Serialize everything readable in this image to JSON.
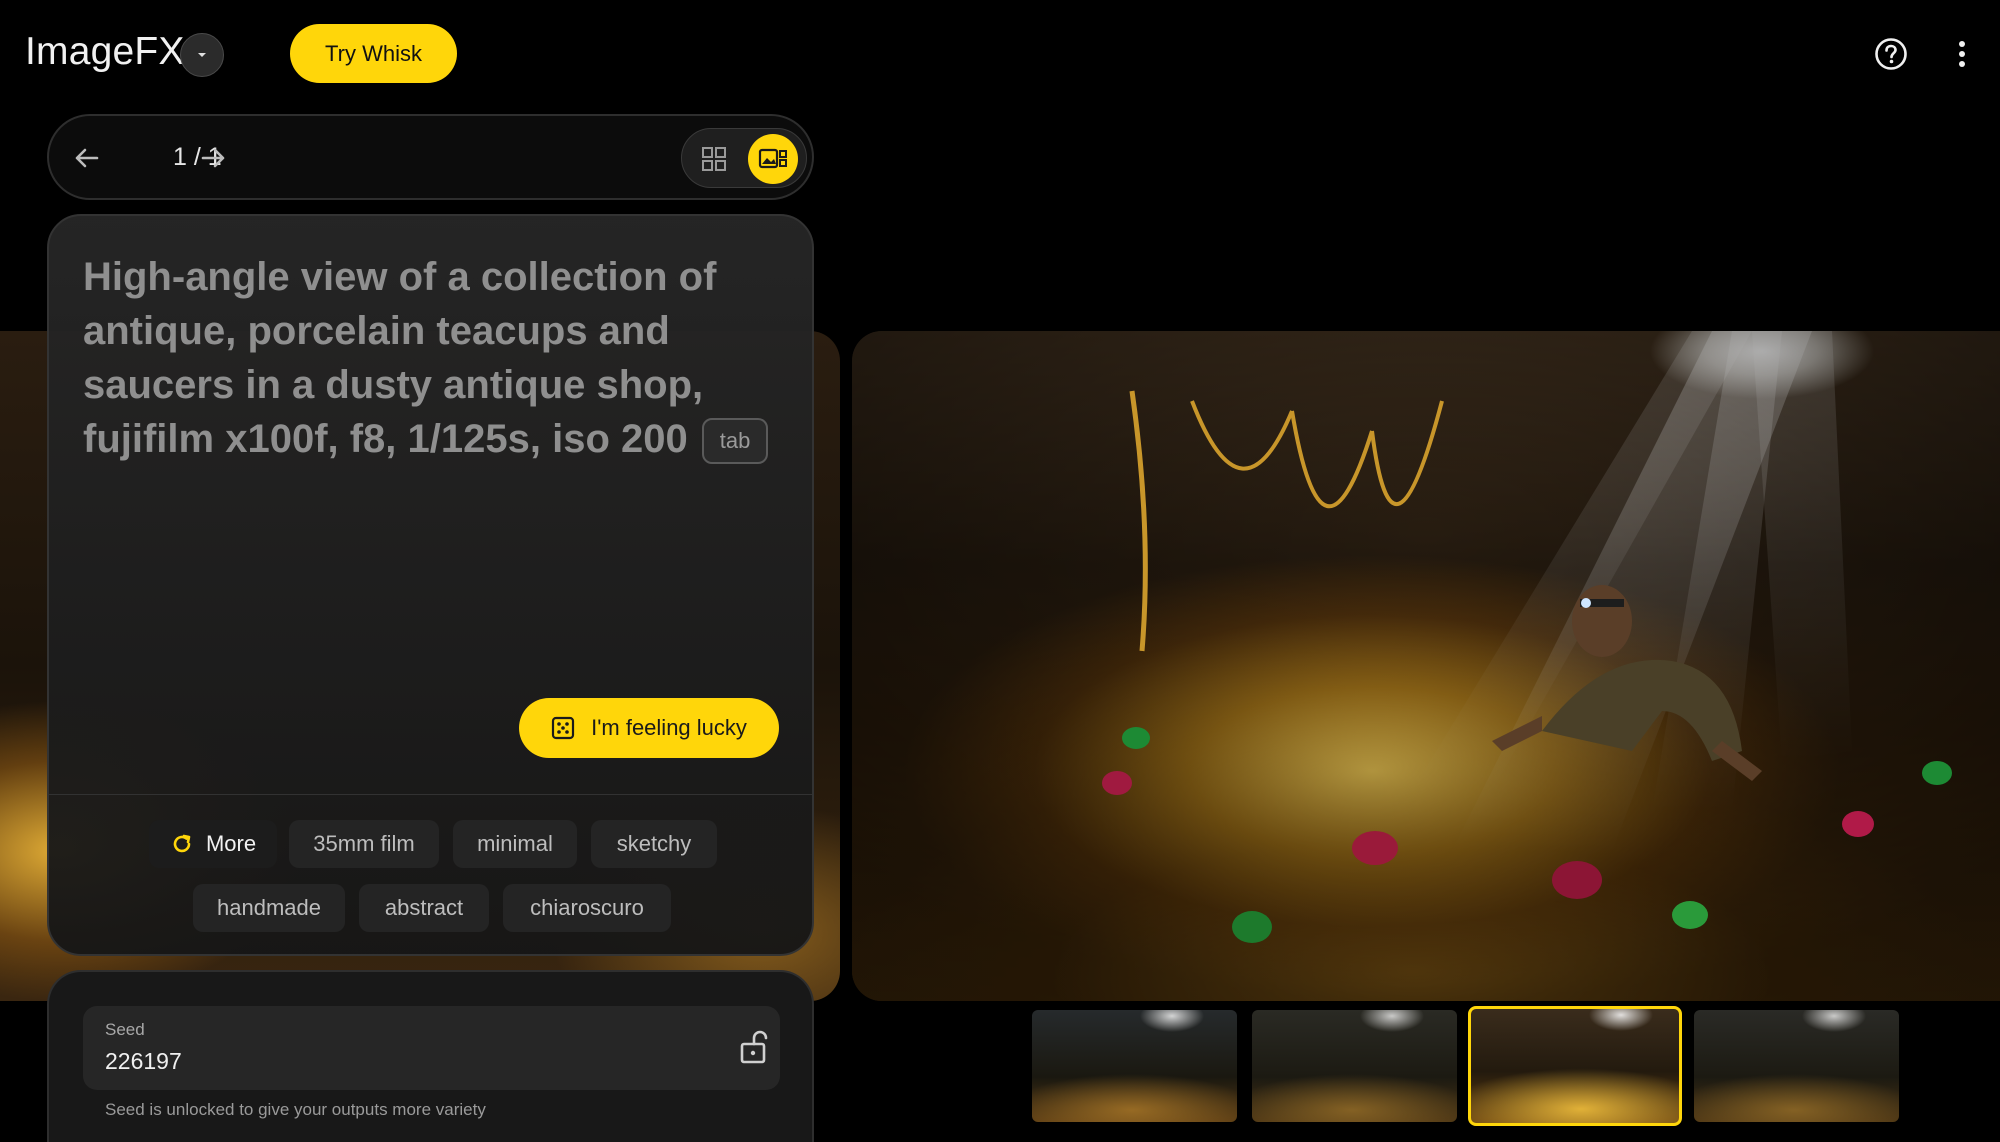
{
  "header": {
    "app_title": "ImageFX",
    "try_button": "Try Whisk"
  },
  "nav": {
    "page_count": "1 / 1"
  },
  "prompt": {
    "text": "High-angle view of a collection of antique, porcelain teacups and saucers in a dusty antique shop, fujifilm x100f, f8, 1/125s, iso 200",
    "tab_hint": "tab",
    "lucky_button": "I'm feeling lucky"
  },
  "chips": {
    "more_label": "More",
    "items": [
      "35mm film",
      "minimal",
      "sketchy",
      "handmade",
      "abstract",
      "chiaroscuro"
    ]
  },
  "seed": {
    "label": "Seed",
    "value": "226197",
    "hint": "Seed is unlocked to give your outputs more variety"
  },
  "colors": {
    "accent": "#ffd60a",
    "background": "#000000",
    "card": "#1e1e1e"
  },
  "thumbnails": {
    "count": 4,
    "selected_index": 2
  }
}
